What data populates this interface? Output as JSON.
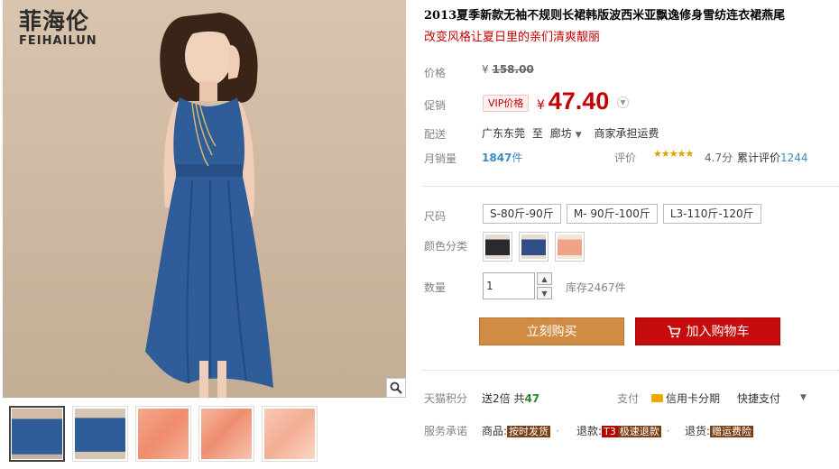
{
  "brand": {
    "name_cn": "菲海伦",
    "name_en": "FEIHAILUN"
  },
  "product": {
    "title": "2013夏季新款无袖不规则长裙韩版波西米亚飘逸修身雪纺连衣裙燕尾",
    "subtitle": "改变风格让夏日里的亲们清爽靓丽"
  },
  "price": {
    "label": "价格",
    "currency": "¥",
    "original": "158.00"
  },
  "promo": {
    "label": "促销",
    "tag": "VIP价格",
    "currency": "¥",
    "value": "47.40"
  },
  "shipping": {
    "label": "配送",
    "from": "广东东莞",
    "to_word": "至",
    "destination": "廊坊",
    "fee": "商家承担运费"
  },
  "sales": {
    "label": "月销量",
    "count": "1847",
    "unit": "件"
  },
  "rating": {
    "label": "评价",
    "stars": "★★★★★",
    "score": "4.7分",
    "reviews_label": "累计评价",
    "reviews_count": "1244"
  },
  "size": {
    "label": "尺码",
    "options": [
      "S-80斤-90斤",
      "M- 90斤-100斤",
      "L3-110斤-120斤"
    ]
  },
  "color": {
    "label": "颜色分类",
    "swatches": [
      "#2a2a2e",
      "#2f4f86",
      "#f1a387"
    ]
  },
  "quantity": {
    "label": "数量",
    "value": "1",
    "stock": "库存2467件"
  },
  "actions": {
    "buy_now": "立刻购买",
    "add_to_cart": "加入购物车"
  },
  "points": {
    "label": "天猫积分",
    "text": "送2倍 共",
    "value": "47"
  },
  "payment": {
    "label": "支付",
    "credit": "信用卡分期",
    "quick": "快捷支付"
  },
  "service": {
    "label": "服务承诺",
    "items": [
      {
        "prefix": "商品:",
        "tag": "按时发货"
      },
      {
        "prefix": "退款:",
        "tag_prefix": "T3",
        "tag": "极速退款"
      },
      {
        "prefix": "退货:",
        "tag": "赠运费险"
      }
    ]
  },
  "colors": {
    "price_red": "#c40000",
    "buy_orange": "#d08c43",
    "cart_red": "#c60c0c",
    "link_blue": "#3c8dbc",
    "dress_blue": "#2f5d99"
  }
}
